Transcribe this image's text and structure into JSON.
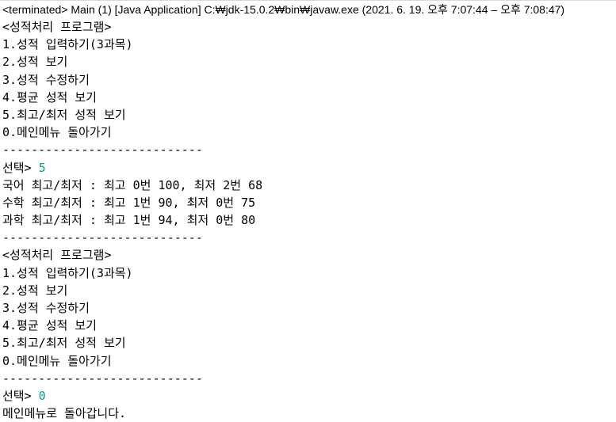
{
  "header": {
    "title": "<terminated> Main (1) [Java Application] C:₩jdk-15.0.2₩bin₩javaw.exe  (2021. 6. 19. 오후 7:07:44 – 오후 7:08:47)"
  },
  "console": {
    "input_color": "#00a08c",
    "lines": [
      {
        "text": "<성적처리 프로그램>"
      },
      {
        "text": "1.성적 입력하기(3과목)"
      },
      {
        "text": "2.성적 보기"
      },
      {
        "text": "3.성적 수정하기"
      },
      {
        "text": "4.평균 성적 보기"
      },
      {
        "text": "5.최고/최저 성적 보기"
      },
      {
        "text": "0.메인메뉴 돌아가기"
      },
      {
        "text": "----------------------------"
      },
      {
        "text": "선택> ",
        "input": "5"
      },
      {
        "text": "국어 최고/최저 : 최고 0번 100, 최저 2번 68"
      },
      {
        "text": "수학 최고/최저 : 최고 1번 90, 최저 0번 75"
      },
      {
        "text": "과학 최고/최저 : 최고 1번 94, 최저 0번 80"
      },
      {
        "text": "----------------------------"
      },
      {
        "text": "<성적처리 프로그램>"
      },
      {
        "text": "1.성적 입력하기(3과목)"
      },
      {
        "text": "2.성적 보기"
      },
      {
        "text": "3.성적 수정하기"
      },
      {
        "text": "4.평균 성적 보기"
      },
      {
        "text": "5.최고/최저 성적 보기"
      },
      {
        "text": "0.메인메뉴 돌아가기"
      },
      {
        "text": "----------------------------"
      },
      {
        "text": "선택> ",
        "input": "0"
      },
      {
        "text": "메인메뉴로 돌아갑니다."
      }
    ]
  }
}
